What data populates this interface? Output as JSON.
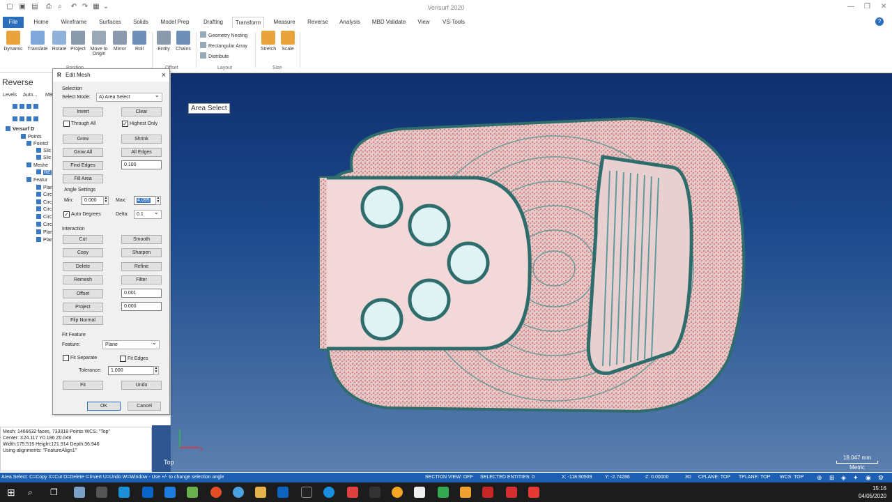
{
  "app": {
    "title": "Verisurf 2020"
  },
  "menu": {
    "tabs": [
      "File",
      "Home",
      "Wireframe",
      "Surfaces",
      "Solids",
      "Model Prep",
      "Drafting",
      "Transform",
      "Measure",
      "Reverse",
      "Analysis",
      "MBD Validate",
      "View",
      "VS-Tools"
    ],
    "active": "Transform"
  },
  "ribbon": {
    "buttons": [
      {
        "label": "Dynamic"
      },
      {
        "label": "Translate"
      },
      {
        "label": "Rotate"
      },
      {
        "label": "Project"
      },
      {
        "label": "Move to Origin"
      },
      {
        "label": "Mirror"
      },
      {
        "label": "Roll"
      },
      {
        "label": "Entity"
      },
      {
        "label": "Chains"
      },
      {
        "label": "Stretch"
      },
      {
        "label": "Scale"
      }
    ],
    "layout_items": [
      "Geometry Nesting",
      "Rectangular Array",
      "Distribute"
    ],
    "groups": {
      "position": "Position",
      "offset": "Offset",
      "layout": "Layout",
      "size": "Size"
    }
  },
  "panel": {
    "title": "Reverse",
    "tabs": [
      "Levels",
      "Auto...",
      "MB"
    ],
    "tree": [
      "Versurf D",
      "Points",
      "Pointcl",
      "Slic",
      "Slic",
      "Meshe",
      "RE",
      "Featur",
      "Plan",
      "Circ",
      "Circ",
      "Circ",
      "Circ",
      "Circ",
      "Plan",
      "Plan"
    ]
  },
  "info": {
    "lines": [
      "Mesh: 1466632 faces, 733318 Points  WCS: \"Top\"",
      "Center: X24.117 Y0.186 Z0.049",
      "Width:175.516 Height:121.914 Depth:36.946",
      "Using alignments: \"FeatureAlign1\""
    ]
  },
  "viewport": {
    "mode_label": "Area Select",
    "view_name": "Top",
    "scale_value": "18.047 mm",
    "scale_unit": "Metric"
  },
  "dialog": {
    "title": "Edit Mesh",
    "selection": {
      "header": "Selection",
      "mode_label": "Select Mode:",
      "mode_value": "A) Area Select",
      "invert": "Invert",
      "clear": "Clear",
      "through_all": "Through All",
      "highest_only": "Highest Only",
      "grow": "Grow",
      "shrink": "Shrink",
      "grow_all": "Grow All",
      "all_edges": "All Edges",
      "find_edges": "Find Edges",
      "find_edges_value": "0.100",
      "fill_area": "Fill Area"
    },
    "angle": {
      "header": "Angle Settings",
      "min_label": "Min:",
      "min_value": "0.000",
      "max_label": "Max:",
      "max_value": "4.095",
      "auto_degrees": "Auto Degrees",
      "delta_label": "Delta:",
      "delta_value": "0.1"
    },
    "interaction": {
      "header": "Interaction",
      "cut": "Cut",
      "smooth": "Smooth",
      "copy": "Copy",
      "sharpen": "Sharpen",
      "delete": "Delete",
      "refine": "Refine",
      "remesh": "Remesh",
      "filter": "Filter",
      "offset": "Offset",
      "offset_value": "0.001",
      "project": "Project",
      "project_value": "0.000",
      "flip_normal": "Flip Normal"
    },
    "fit": {
      "header": "Fit Feature",
      "feature_label": "Feature:",
      "feature_value": "Plane",
      "fit_separate": "Fit Separate",
      "fit_edges": "Fit Edges",
      "tolerance_label": "Tolerance:",
      "tolerance_value": "1.000",
      "fit": "Fit",
      "undo": "Undo"
    },
    "ok": "OK",
    "cancel": "Cancel"
  },
  "status": {
    "hint": "Area Select: C=Copy X=Cut D=Delete I=Invert U=Undo W=Window - Use +/- to change selection angle",
    "section": "SECTION VIEW: OFF",
    "selected": "SELECTED ENTITIES: 0",
    "x": "X:   -118.90509",
    "y": "Y:   -2.74286",
    "z": "Z:   0.00000",
    "mode3d": "3D",
    "cplane": "CPLANE: TOP",
    "tplane": "TPLANE: TOP",
    "wcs": "WCS: TOP"
  },
  "taskbar": {
    "time": "15:16",
    "date": "04/05/2020"
  }
}
